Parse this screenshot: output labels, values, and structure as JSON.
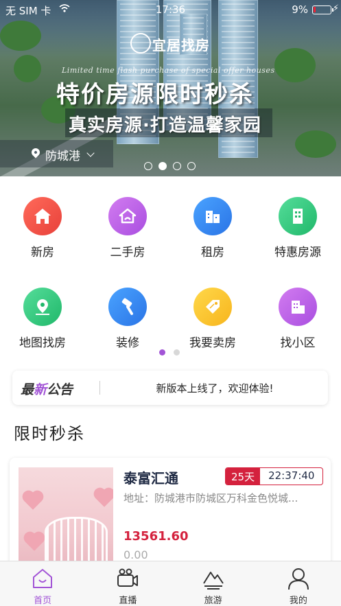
{
  "status_bar": {
    "carrier": "无 SIM 卡",
    "time": "17:36",
    "battery": "9%",
    "icons": [
      "wifi-icon",
      "battery-icon",
      "charging-icon"
    ]
  },
  "banner": {
    "brand": "宜居找房",
    "tagline_en": "Limited time flash purchase of special offer houses",
    "title": "特价房源限时秒杀",
    "subtitle": "真实房源·打造温馨家园",
    "city": "防城港",
    "slide_count": 4,
    "active_slide": 2
  },
  "categories": [
    {
      "label": "新房",
      "icon": "house-icon",
      "color": "#e8413a"
    },
    {
      "label": "二手房",
      "icon": "second-hand-house-icon",
      "color": "#a94ee0"
    },
    {
      "label": "租房",
      "icon": "rent-building-icon",
      "color": "#2a74e6"
    },
    {
      "label": "特惠房源",
      "icon": "discount-building-icon",
      "color": "#20b86a"
    },
    {
      "label": "地图找房",
      "icon": "map-pin-icon",
      "color": "#20b86a"
    },
    {
      "label": "装修",
      "icon": "paint-roller-icon",
      "color": "#2a74e6"
    },
    {
      "label": "我要卖房",
      "icon": "price-tag-icon",
      "color": "#f7b51d"
    },
    {
      "label": "找小区",
      "icon": "community-building-icon",
      "color": "#a94ee0"
    }
  ],
  "category_pages": {
    "count": 2,
    "active": 1
  },
  "notice": {
    "brand_prefix": "最",
    "brand_highlight": "新",
    "brand_suffix": "公告",
    "text": "新版本上线了，欢迎体验!"
  },
  "section": {
    "title": "限时秒杀"
  },
  "listing": {
    "title": "泰富汇通",
    "countdown_days": "25天",
    "countdown_time": "22:37:40",
    "address": "地址：防城港市防城区万科金色悦城...",
    "price": "13561.60",
    "original_price": "0.00"
  },
  "tabs": [
    {
      "label": "首页",
      "icon": "home-icon",
      "active": true
    },
    {
      "label": "直播",
      "icon": "video-camera-icon",
      "active": false
    },
    {
      "label": "旅游",
      "icon": "mountain-icon",
      "active": false
    },
    {
      "label": "我的",
      "icon": "user-icon",
      "active": false
    }
  ],
  "colors": {
    "accent": "#a254d6",
    "price_red": "#d4213d",
    "title_navy": "#1f2a44"
  }
}
